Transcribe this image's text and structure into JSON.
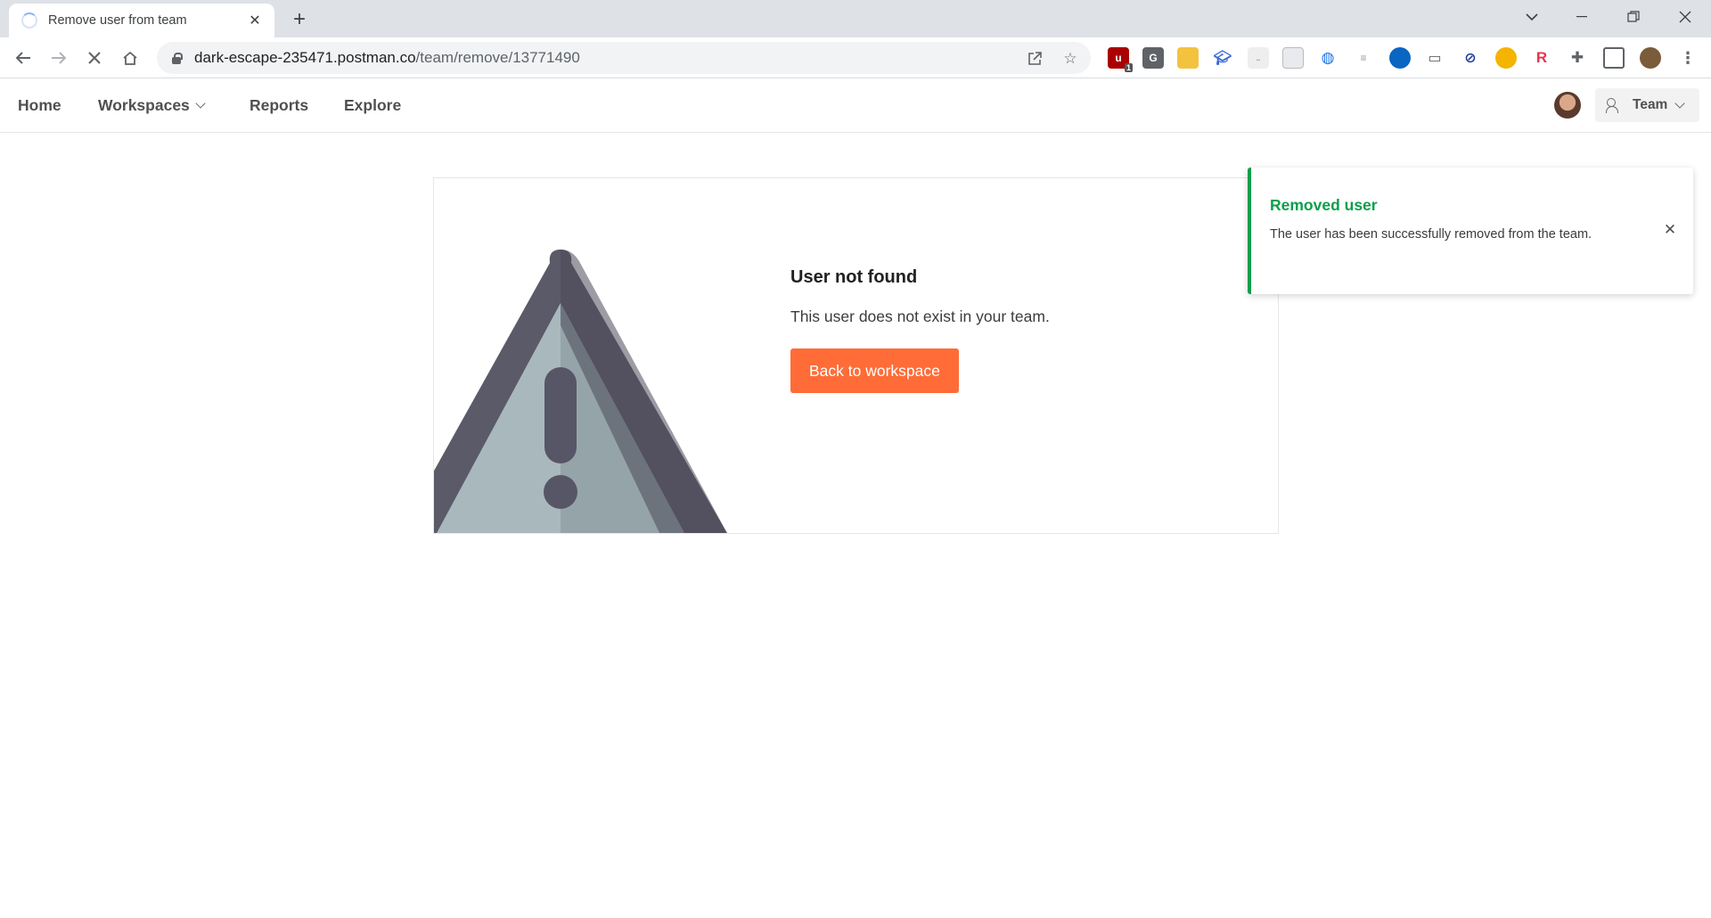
{
  "browser": {
    "tab_title": "Remove user from team",
    "url_domain": "dark-escape-235471.postman.co",
    "url_path": "/team/remove/13771490",
    "extensions": [
      "ublock-icon",
      "grammarly-icon",
      "search-extension-icon",
      "graduation-cap-icon",
      "ext-icon",
      "sheet-icon",
      "globe-icon",
      "list-icon",
      "onedrive-icon",
      "laptop-icon",
      "compass-icon",
      "speed-icon",
      "r-icon",
      "puzzle-icon",
      "sidepanel-icon",
      "profile-icon"
    ],
    "ublock_badge": "1"
  },
  "nav": {
    "home": "Home",
    "workspaces": "Workspaces",
    "reports": "Reports",
    "explore": "Explore",
    "team": "Team"
  },
  "error_card": {
    "title": "User not found",
    "message": "This user does not exist in your team.",
    "button": "Back to workspace"
  },
  "toast": {
    "title": "Removed user",
    "message": "The user has been successfully removed from the team."
  },
  "colors": {
    "accent": "#ff6c37",
    "success": "#0c9e4a"
  }
}
